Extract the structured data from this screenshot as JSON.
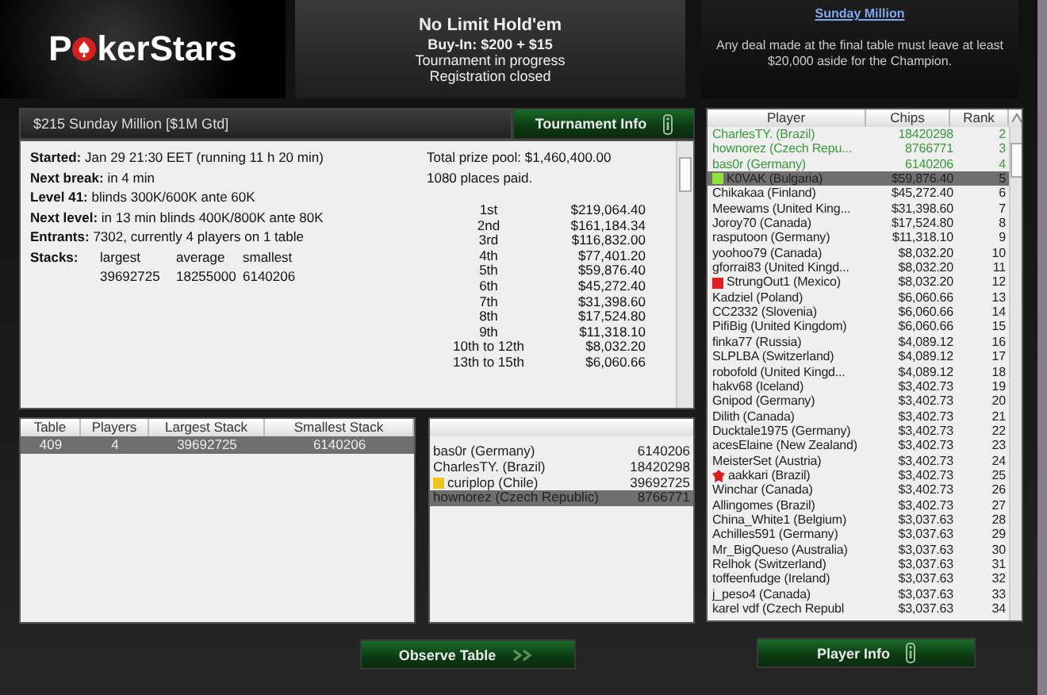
{
  "logo": {
    "before": "P",
    "after": "kerStars"
  },
  "game": {
    "title": "No Limit Hold'em",
    "buy_in": "Buy-In: $200 + $15",
    "status": "Tournament in progress",
    "registration": "Registration closed"
  },
  "notice": {
    "link": "Sunday Million",
    "text": "Any deal made at the final table must leave at least $20,000 aside for the Champion."
  },
  "tournament_bar": {
    "title": "$215 Sunday Million [$1M Gtd]",
    "button": "Tournament Info"
  },
  "info": [
    {
      "label": "Started:",
      "value": "Jan 29 21:30 EET (running 11 h 20 min)"
    },
    {
      "label": "Next break:",
      "value": "in 4 min"
    },
    {
      "label": "Level 41:",
      "value": "blinds 300K/600K ante 60K"
    },
    {
      "label": "Next level:",
      "value": "in 13 min blinds 400K/800K ante 80K"
    },
    {
      "label": "Entrants:",
      "value": "7302, currently 4 players on 1 table"
    }
  ],
  "stacks": {
    "label": "Stacks:",
    "columns": [
      "largest",
      "average",
      "smallest"
    ],
    "values": [
      "39692725",
      "18255000",
      "6140206"
    ]
  },
  "prizes": {
    "pool": "Total prize pool: $1,460,400.00",
    "paid": "1080 places paid.",
    "rows": [
      {
        "place": "1st",
        "amount": "$219,064.40"
      },
      {
        "place": "2nd",
        "amount": "$161,184.34"
      },
      {
        "place": "3rd",
        "amount": "$116,832.00"
      },
      {
        "place": "4th",
        "amount": "$77,401.20"
      },
      {
        "place": "5th",
        "amount": "$59,876.40"
      },
      {
        "place": "6th",
        "amount": "$45,272.40"
      },
      {
        "place": "7th",
        "amount": "$31,398.60"
      },
      {
        "place": "8th",
        "amount": "$17,524.80"
      },
      {
        "place": "9th",
        "amount": "$11,318.10"
      },
      {
        "place": "10th to 12th",
        "amount": "$8,032.20"
      },
      {
        "place": "13th to 15th",
        "amount": "$6,060.66"
      }
    ]
  },
  "tables": {
    "columns": [
      "Table",
      "Players",
      "Largest Stack",
      "Smallest Stack"
    ],
    "rows": [
      {
        "cells": [
          "409",
          "4",
          "39692725",
          "6140206"
        ],
        "selected": true
      }
    ]
  },
  "table_players": [
    {
      "name": "bas0r (Germany)",
      "chips": "6140206",
      "selected": false
    },
    {
      "name": "CharlesTY. (Brazil)",
      "chips": "18420298",
      "selected": false
    },
    {
      "name": "curiplop (Chile)",
      "chips": "39692725",
      "selected": false,
      "marker": {
        "kind": "square",
        "color": "#f0c419"
      }
    },
    {
      "name": "hownorez (Czech Republic)",
      "chips": "8766771",
      "selected": true
    }
  ],
  "players": {
    "columns": [
      "Player",
      "Chips",
      "Rank"
    ],
    "rows": [
      {
        "name": "CharlesTY. (Brazil)",
        "chips": "18420298",
        "rank": "2",
        "in_play": true,
        "selected": false
      },
      {
        "name": "hownorez (Czech Repu...",
        "chips": "8766771",
        "rank": "3",
        "in_play": true,
        "selected": false
      },
      {
        "name": "bas0r (Germany)",
        "chips": "6140206",
        "rank": "4",
        "in_play": true,
        "selected": false
      },
      {
        "name": "K0VAK (Bulgaria)",
        "chips": "$59,876.40",
        "rank": "5",
        "in_play": false,
        "selected": true,
        "marker": {
          "kind": "square",
          "color": "#8ee03a"
        }
      },
      {
        "name": "Chikakaa (Finland)",
        "chips": "$45,272.40",
        "rank": "6",
        "in_play": false,
        "selected": false
      },
      {
        "name": "Meewams (United King...",
        "chips": "$31,398.60",
        "rank": "7",
        "in_play": false,
        "selected": false
      },
      {
        "name": "Joroy70 (Canada)",
        "chips": "$17,524.80",
        "rank": "8",
        "in_play": false,
        "selected": false
      },
      {
        "name": "rasputoon (Germany)",
        "chips": "$11,318.10",
        "rank": "9",
        "in_play": false,
        "selected": false
      },
      {
        "name": "yoohoo79 (Canada)",
        "chips": "$8,032.20",
        "rank": "10",
        "in_play": false,
        "selected": false
      },
      {
        "name": "gforrai83 (United Kingd...",
        "chips": "$8,032.20",
        "rank": "11",
        "in_play": false,
        "selected": false
      },
      {
        "name": "StrungOut1 (Mexico)",
        "chips": "$8,032.20",
        "rank": "12",
        "in_play": false,
        "selected": false,
        "marker": {
          "kind": "square",
          "color": "#e02020"
        }
      },
      {
        "name": "Kadziel (Poland)",
        "chips": "$6,060.66",
        "rank": "13",
        "in_play": false,
        "selected": false
      },
      {
        "name": "CC2332 (Slovenia)",
        "chips": "$6,060.66",
        "rank": "14",
        "in_play": false,
        "selected": false
      },
      {
        "name": "PifiBig (United Kingdom)",
        "chips": "$6,060.66",
        "rank": "15",
        "in_play": false,
        "selected": false
      },
      {
        "name": "finka77 (Russia)",
        "chips": "$4,089.12",
        "rank": "16",
        "in_play": false,
        "selected": false
      },
      {
        "name": "SLPLBA (Switzerland)",
        "chips": "$4,089.12",
        "rank": "17",
        "in_play": false,
        "selected": false
      },
      {
        "name": "robofold (United Kingd...",
        "chips": "$4,089.12",
        "rank": "18",
        "in_play": false,
        "selected": false
      },
      {
        "name": "hakv68 (Iceland)",
        "chips": "$3,402.73",
        "rank": "19",
        "in_play": false,
        "selected": false
      },
      {
        "name": "Gnipod (Germany)",
        "chips": "$3,402.73",
        "rank": "20",
        "in_play": false,
        "selected": false
      },
      {
        "name": "Dilith (Canada)",
        "chips": "$3,402.73",
        "rank": "21",
        "in_play": false,
        "selected": false
      },
      {
        "name": "Ducktale1975 (Germany)",
        "chips": "$3,402.73",
        "rank": "22",
        "in_play": false,
        "selected": false
      },
      {
        "name": "acesElaine (New Zealand)",
        "chips": "$3,402.73",
        "rank": "23",
        "in_play": false,
        "selected": false
      },
      {
        "name": "MeisterSet (Austria)",
        "chips": "$3,402.73",
        "rank": "24",
        "in_play": false,
        "selected": false
      },
      {
        "name": "aakkari (Brazil)",
        "chips": "$3,402.73",
        "rank": "25",
        "in_play": false,
        "selected": false,
        "marker": {
          "kind": "star"
        }
      },
      {
        "name": "Winchar (Canada)",
        "chips": "$3,402.73",
        "rank": "26",
        "in_play": false,
        "selected": false
      },
      {
        "name": "Allingomes (Brazil)",
        "chips": "$3,402.73",
        "rank": "27",
        "in_play": false,
        "selected": false
      },
      {
        "name": "China_White1 (Belgium)",
        "chips": "$3,037.63",
        "rank": "28",
        "in_play": false,
        "selected": false
      },
      {
        "name": "Achilles591 (Germany)",
        "chips": "$3,037.63",
        "rank": "29",
        "in_play": false,
        "selected": false
      },
      {
        "name": "Mr_BigQueso (Australia)",
        "chips": "$3,037.63",
        "rank": "30",
        "in_play": false,
        "selected": false
      },
      {
        "name": "Relhok (Switzerland)",
        "chips": "$3,037.63",
        "rank": "31",
        "in_play": false,
        "selected": false
      },
      {
        "name": "toffeenfudge (Ireland)",
        "chips": "$3,037.63",
        "rank": "32",
        "in_play": false,
        "selected": false
      },
      {
        "name": "j_peso4 (Canada)",
        "chips": "$3,037.63",
        "rank": "33",
        "in_play": false,
        "selected": false
      },
      {
        "name": "karel vdf (Czech Republ",
        "chips": "$3,037.63",
        "rank": "34",
        "in_play": false,
        "selected": false
      }
    ]
  },
  "buttons": {
    "observe": "Observe Table",
    "player_info": "Player Info"
  }
}
